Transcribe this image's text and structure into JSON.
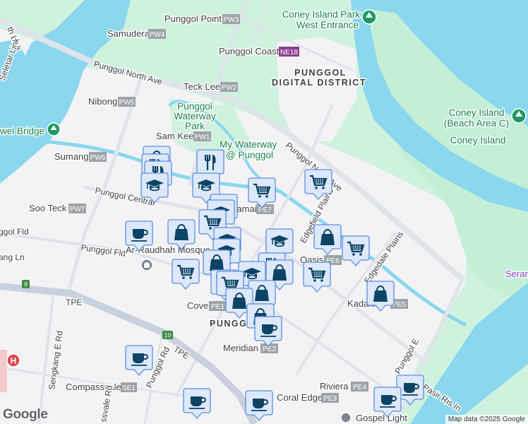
{
  "map": {
    "credit": "Map data ©2025 Google",
    "logo": "Google",
    "colors": {
      "water": "#8ad7ee",
      "park": "#cdf1dd",
      "land": "#f3f3f5",
      "marker_fill": "#dde8fb",
      "marker_border": "#5b8fe0",
      "icon": "#0d4466",
      "station_badge": "#9ea3a8",
      "mrt_badge": "#8d3f91",
      "park_label": "#16804e"
    }
  },
  "labels": {
    "th_link": "th Link",
    "seletar_link": "Seletar Link",
    "punggol_point": "Punggol Point",
    "pw3": "PW3",
    "samudera": "Samudera",
    "pw4": "PW4",
    "punggol_coast": "Punggol Coast",
    "ne18": "NE18",
    "coney_park_1": "Coney Island Park",
    "coney_park_2": "West Entrance",
    "digital_1": "PUNGGOL",
    "digital_2": "DIGITAL DISTRICT",
    "north_ave": "Punggol North Ave",
    "north_ave_2": "Punggol North Ave",
    "teck_lee": "Teck Lee",
    "pw2": "PW2",
    "nibong": "Nibong",
    "pw5": "PW5",
    "waterway_park_1": "Punggol",
    "waterway_park_2": "Waterway",
    "waterway_park_3": "Park",
    "sam_kee": "Sam Kee",
    "pw1": "PW1",
    "my_waterway_1": "My Waterway",
    "my_waterway_2": "@ Punggol",
    "jewel_bridge": "wel Bridge",
    "sumang": "Sumang",
    "pw6": "PW6",
    "punggol_central": "Punggol Central",
    "soo_teck": "Soo Teck",
    "pw7": "PW7",
    "damai": "Damai",
    "pe7": "PE7",
    "ggol_fld": "ggol Fld",
    "ang_ln": "ang Ln",
    "punggol_fld": "Punggol Fld",
    "mosque": "Ar-Raudhah Mosque",
    "edgefield": "Edgefield Plains",
    "oasis": "Oasis",
    "pe6": "PE6",
    "edgedale": "Edgedale Plains",
    "kadaloor": "Kadaloor",
    "pe5": "PE5",
    "cove": "Cove",
    "pe1": "PE1",
    "punggol": "PUNGGOL",
    "meridian": "Meridian",
    "pe2": "PE2",
    "tpe_1": "TPE",
    "tpe_2": "TPE",
    "sengkang_e_rd": "Sengkang E Rd",
    "punggol_rd": "Punggol Rd",
    "compassvale": "Compassvale",
    "se1": "SE1",
    "compassvale_rd": "ssvale Rd",
    "coral_edge": "Coral Edge",
    "pe3": "PE3",
    "riviera": "Riviera",
    "pe4": "PE4",
    "punggol_e": "Punggol E",
    "pasir_ris": "Pasir Ris In",
    "gospel_light": "Gospel Light",
    "coney_beach_1": "Coney Island",
    "coney_beach_2": "(Beach Area C)",
    "coney_island": "Coney Island",
    "serangoon": "Seran",
    "shield_9": "9",
    "shield_10": "10",
    "hospital": "H"
  },
  "markers": [
    {
      "type": "bag"
    },
    {
      "type": "restaurant"
    },
    {
      "type": "restaurant"
    },
    {
      "type": "school"
    },
    {
      "type": "restaurant"
    },
    {
      "type": "school"
    },
    {
      "type": "cart"
    },
    {
      "type": "cart"
    },
    {
      "type": "school"
    },
    {
      "type": "school"
    },
    {
      "type": "cart"
    },
    {
      "type": "bag"
    },
    {
      "type": "coffee"
    },
    {
      "type": "school"
    },
    {
      "type": "school"
    },
    {
      "type": "school"
    },
    {
      "type": "bag"
    },
    {
      "type": "cart"
    },
    {
      "type": "bag"
    },
    {
      "type": "restaurant"
    },
    {
      "type": "cart"
    },
    {
      "type": "bag"
    },
    {
      "type": "school"
    },
    {
      "type": "cart"
    },
    {
      "type": "cart"
    },
    {
      "type": "cart"
    },
    {
      "type": "bag"
    },
    {
      "type": "bag"
    },
    {
      "type": "bag"
    },
    {
      "type": "bag"
    },
    {
      "type": "coffee"
    },
    {
      "type": "coffee"
    },
    {
      "type": "coffee"
    },
    {
      "type": "coffee"
    },
    {
      "type": "coffee"
    },
    {
      "type": "coffee"
    }
  ]
}
